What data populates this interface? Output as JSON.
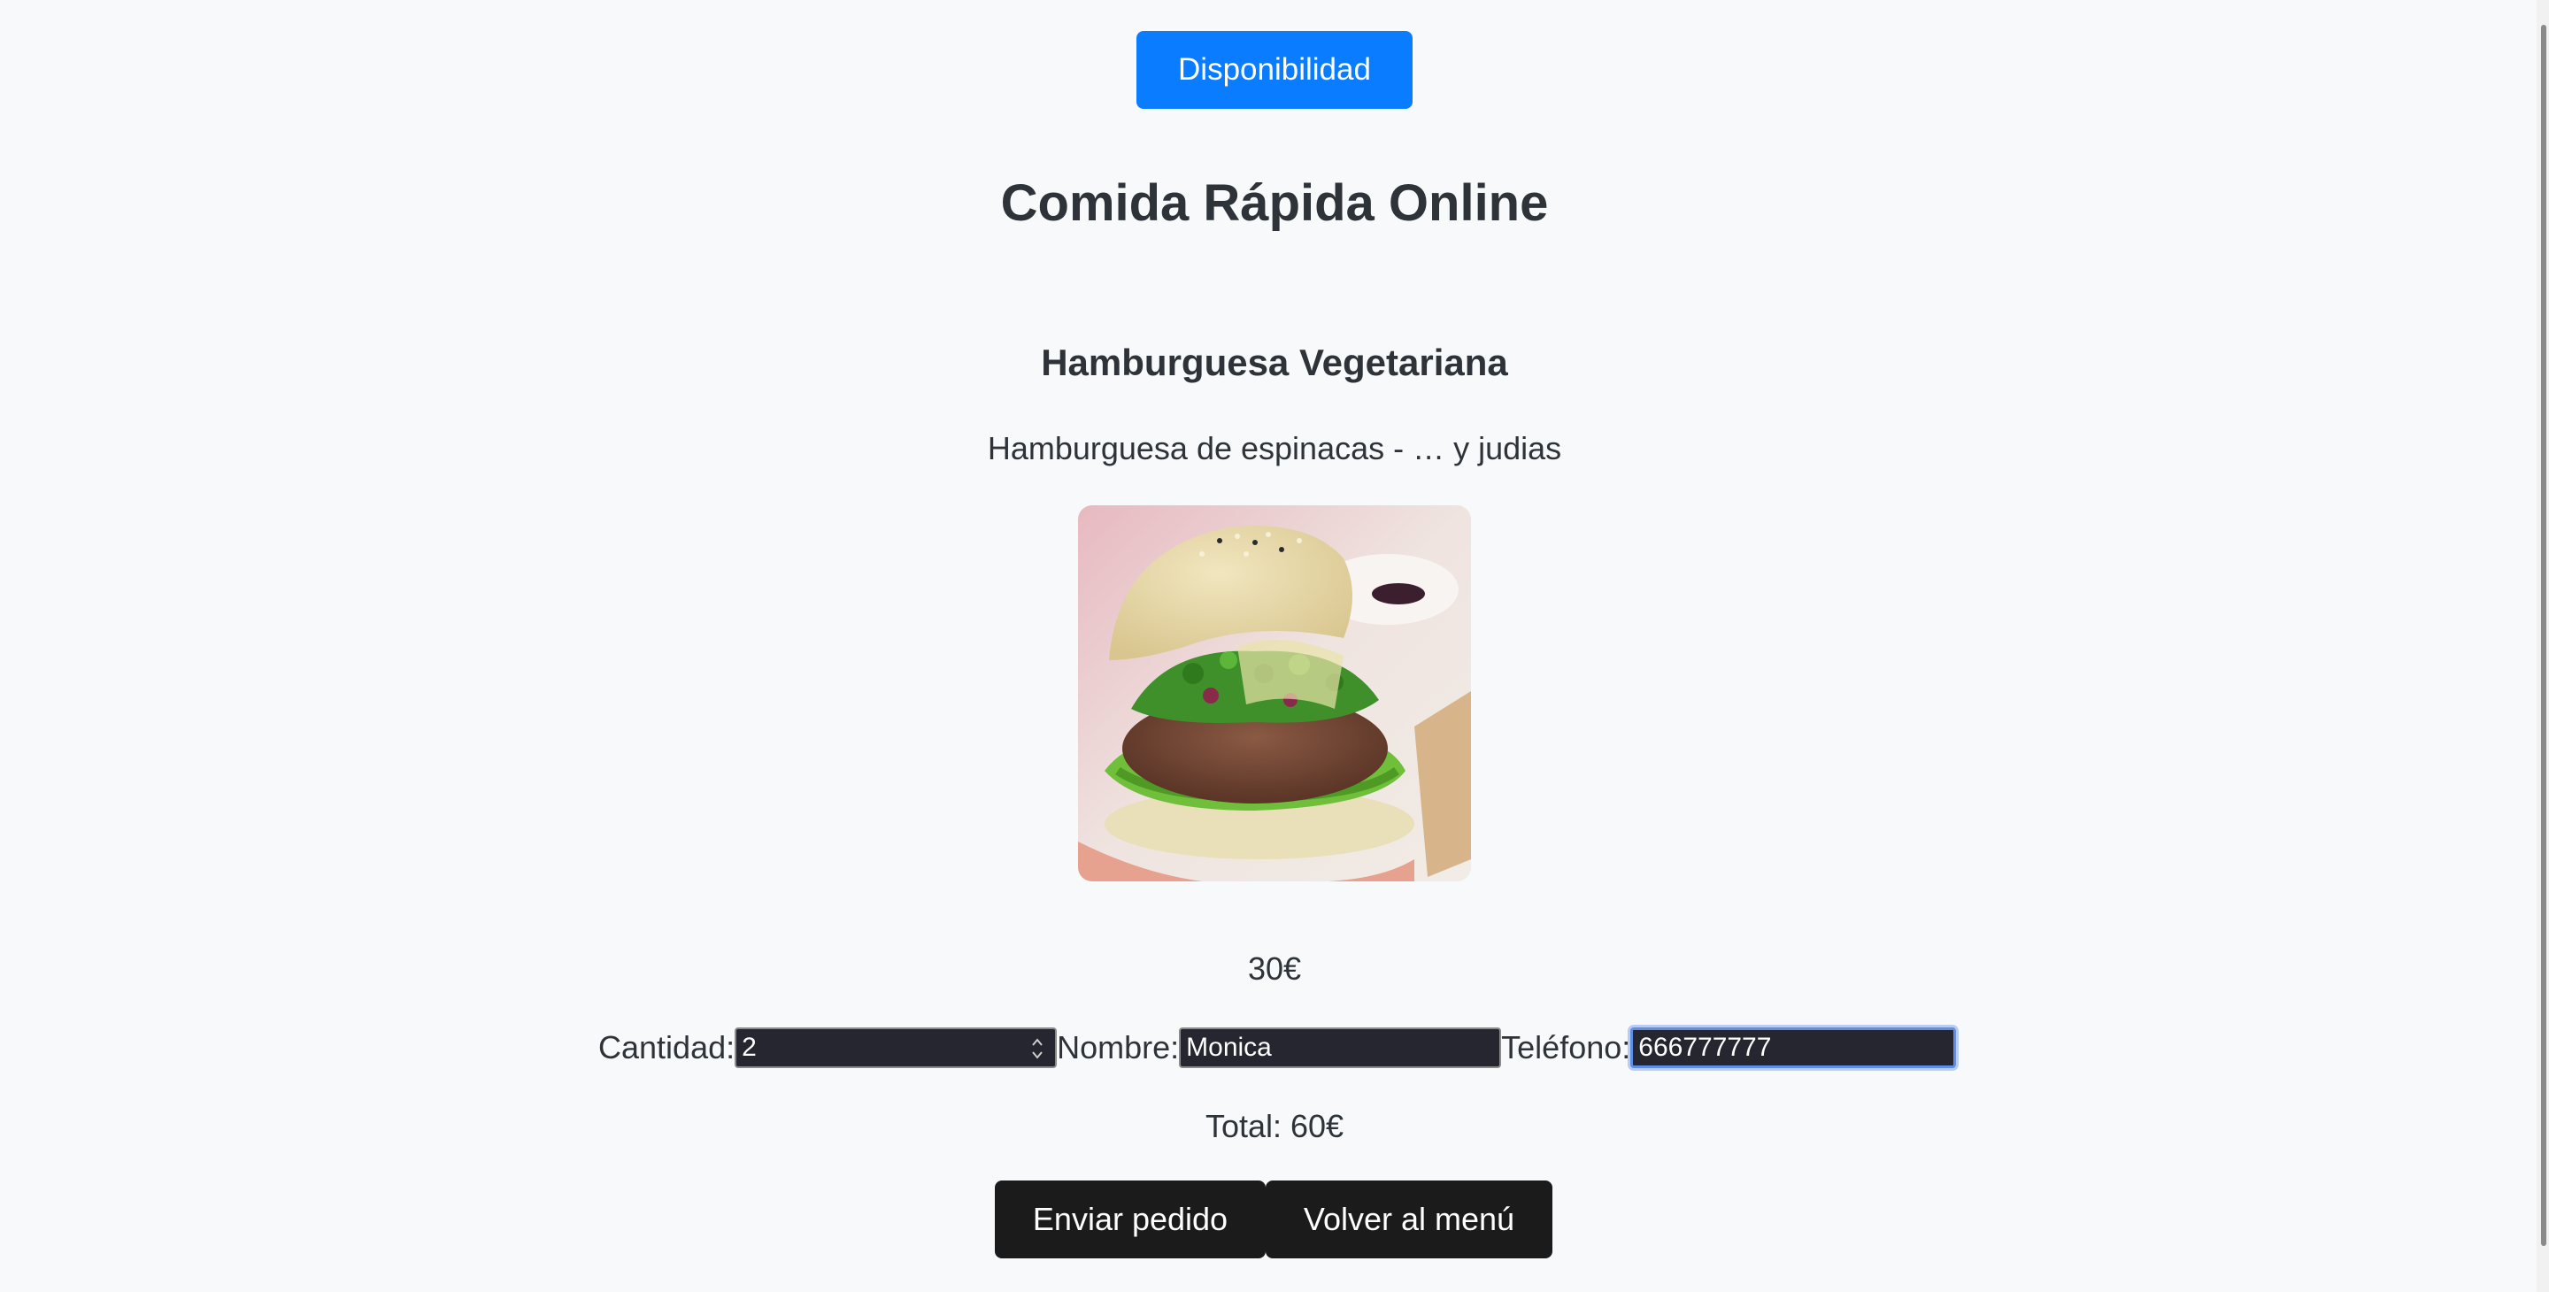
{
  "header": {
    "availability_label": "Disponibilidad",
    "title": "Comida Rápida Online"
  },
  "product": {
    "name": "Hamburguesa Vegetariana",
    "description": "Hamburguesa de espinacas - … y judias",
    "image_icon": "veggie-burger-photo",
    "price": "30€"
  },
  "form": {
    "quantity_label": "Cantidad:",
    "quantity_value": "2",
    "name_label": "Nombre:",
    "name_value": "Monica",
    "phone_label": "Teléfono:",
    "phone_value": "666777777"
  },
  "total": "Total: 60€",
  "actions": {
    "send_label": "Enviar pedido",
    "back_label": "Volver al menú"
  },
  "colors": {
    "accent": "#0a7cff",
    "dark_button": "#1b1b1b",
    "background": "#f8f9fa",
    "input_bg": "#252630"
  }
}
